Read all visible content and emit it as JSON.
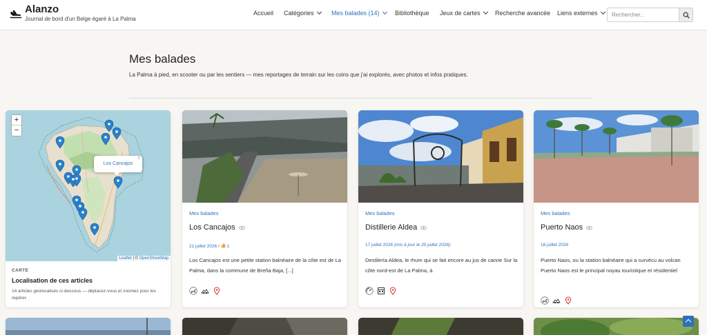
{
  "brand": {
    "title": "Alanzo",
    "tagline": "Journal de bord d'un Belge égaré à La Palma"
  },
  "nav": [
    {
      "label": "Accueil",
      "dropdown": false,
      "active": false
    },
    {
      "label": "Catégories",
      "dropdown": true,
      "active": false
    },
    {
      "label": "Mes balades (14)",
      "dropdown": true,
      "active": true
    },
    {
      "label": "Bibliothèque",
      "dropdown": false,
      "active": false
    },
    {
      "label": "Jeux de cartes",
      "dropdown": true,
      "active": false
    },
    {
      "label": "Recherche avancée",
      "dropdown": false,
      "active": false
    },
    {
      "label": "Liens externes",
      "dropdown": true,
      "active": false
    }
  ],
  "search": {
    "placeholder": "Rechercher..."
  },
  "page": {
    "title": "Mes balades",
    "intro": "La Palma à pied, en scooter ou par les sentiers — mes reportages de terrain sur les coins que j'ai explorés, avec photos et infos pratiques."
  },
  "map_card": {
    "zoom_in": "+",
    "zoom_out": "−",
    "popup": "Los Cancajos",
    "popup_close": "×",
    "attribution_leaflet": "Leaflet",
    "attribution_sep": " | © ",
    "attribution_osm": "OpenStreetMap",
    "label": "CARTE",
    "title": "Localisation de ces articles",
    "desc": "14 articles géolocalisés ci-dessous — déplacez-vous et zoomez pour les repérer."
  },
  "cards": [
    {
      "category": "Mes balades",
      "title": "Los Cancajos",
      "date": "21 juillet 2026 / ",
      "date_note": "",
      "likes": "1",
      "excerpt": "Los Cancajos est une petite station balnéaire de la côte est de La Palma, dans la commune de Breña Baja, [...]",
      "icons": [
        "scooter-icon",
        "hike-icon",
        "location-pin-icon"
      ]
    },
    {
      "category": "Mes balades",
      "title": "Distillerie Aldea",
      "date": "17 juillet 2026",
      "date_note": "(mis à jour le 20 juillet 2026)",
      "likes": "",
      "excerpt": "Destilería Aldea, le rhum qui se fait encore au jus de canne Sur la côte nord-est de La Palma, à",
      "icons": [
        "dial-icon",
        "building-icon",
        "location-pin-icon"
      ]
    },
    {
      "category": "Mes balades",
      "title": "Puerto Naos",
      "date": "16 juillet 2026",
      "date_note": "",
      "likes": "",
      "excerpt": "Puerto Naos, ou la station balnéaire qui a survécu au volcan Puerto Naos est le principal noyau touristique et résidentiel",
      "icons": [
        "scooter-icon",
        "hike-icon",
        "location-pin-icon"
      ]
    }
  ],
  "colors": {
    "accent": "#2e71b9",
    "background": "#f7f6f2",
    "marker": "#2a81cb"
  }
}
